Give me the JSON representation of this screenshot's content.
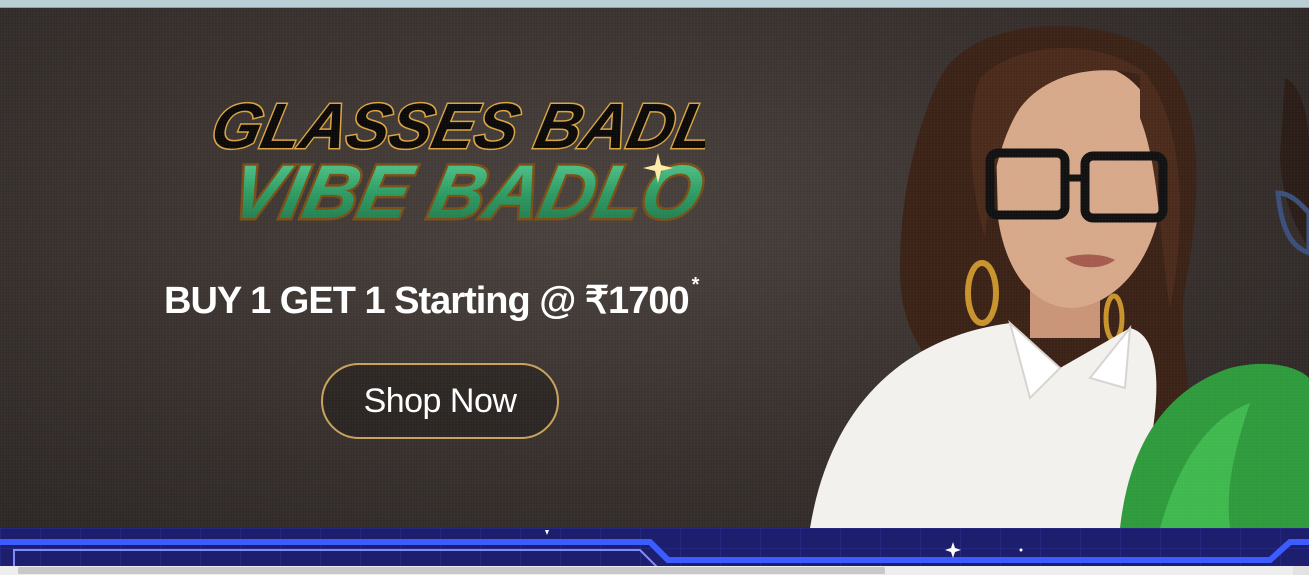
{
  "banner": {
    "logo_line1": "GLASSES BADLO",
    "logo_line2": "VIBE BADLO",
    "headline": "BUY 1 GET 1 Starting @ ₹1700",
    "headline_mark": "*",
    "cta_label": "Shop Now"
  },
  "colors": {
    "banner_bg": "#3a3330",
    "logo_green": "#2f9c64",
    "logo_gold": "#d9a441",
    "cta_border": "#c9a35a",
    "bottom_band": "#1d1f6e"
  },
  "icons": {
    "sparkle": "sparkle-icon"
  }
}
